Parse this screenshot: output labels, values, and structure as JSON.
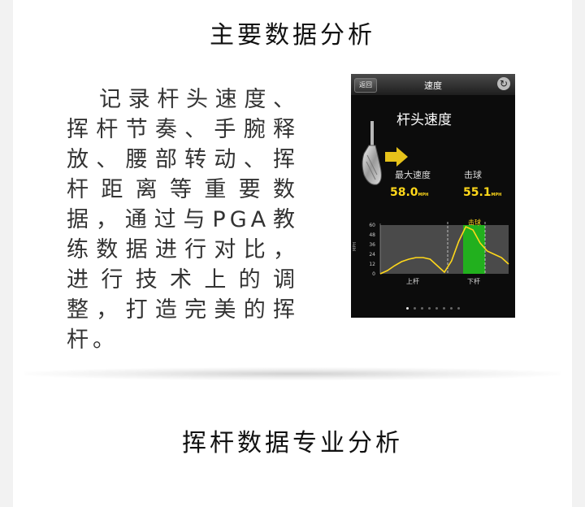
{
  "section1": {
    "title": "主要数据分析",
    "description": "记录杆头速度、挥杆节奏、手腕释放、腰部转动、挥杆距离等重要数据，通过与PGA教练数据进行对比，进行技术上的调整，打造完美的挥杆。"
  },
  "section2": {
    "title": "挥杆数据专业分析"
  },
  "phone": {
    "nav": {
      "back_label": "返回",
      "title": "速度",
      "refresh_icon": "refresh-icon"
    },
    "screen_title": "杆头速度",
    "max_speed": {
      "label": "最大速度",
      "value": "58.0",
      "unit": "MPH"
    },
    "impact": {
      "label": "击球",
      "value": "55.1",
      "unit": "MPH"
    },
    "chart": {
      "ylabel": "MPH",
      "y_ticks": [
        "60",
        "48",
        "36",
        "24",
        "12",
        "0"
      ],
      "upswing_label": "上杆",
      "downswing_label": "下杆",
      "impact_label": "击球"
    },
    "page_dots": 8,
    "active_dot": 0,
    "colors": {
      "accent": "#ffd81a",
      "impact_band": "#22b01e",
      "arrow": "#e6c21a"
    }
  },
  "chart_data": {
    "type": "line",
    "ylabel": "MPH",
    "ylim": [
      0,
      60
    ],
    "y_ticks": [
      0,
      12,
      24,
      36,
      48,
      60
    ],
    "x_labels": [
      "上杆",
      "下杆"
    ],
    "annotations": [
      "击球"
    ],
    "series": [
      {
        "values": [
          0,
          4,
          10,
          15,
          18,
          20,
          20,
          18,
          10,
          2,
          16,
          40,
          58,
          54,
          38,
          28,
          24,
          20,
          12
        ]
      }
    ]
  }
}
